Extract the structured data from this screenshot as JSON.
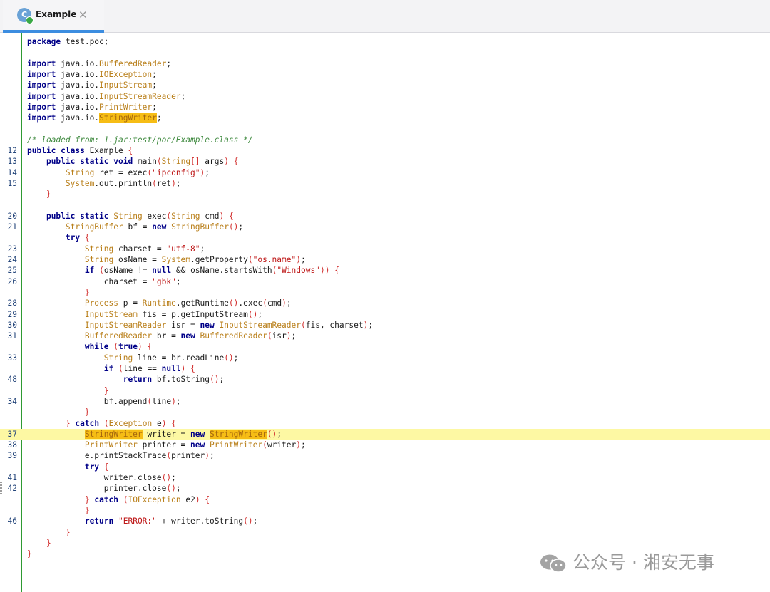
{
  "tab": {
    "title": "Example",
    "icon_letter": "C",
    "close_glyph": "✕"
  },
  "watermark": {
    "text": "公众号 · 湘安无事"
  },
  "colors": {
    "keyword": "#000088",
    "type": "#b97f1a",
    "string": "#bd1515",
    "comment": "#3f8a3f",
    "brace": "#d2302f",
    "highlight": "#f6bd15",
    "current_line": "#fdf8a3",
    "gutter_border": "#2e9a32"
  },
  "code_lines": [
    {
      "ln": "",
      "tokens": [
        [
          "kw",
          "package"
        ],
        [
          "pl",
          " test.poc;"
        ]
      ]
    },
    {
      "ln": "",
      "tokens": []
    },
    {
      "ln": "",
      "tokens": [
        [
          "kw",
          "import"
        ],
        [
          "pl",
          " java.io."
        ],
        [
          "ty",
          "BufferedReader"
        ],
        [
          "pl",
          ";"
        ]
      ]
    },
    {
      "ln": "",
      "tokens": [
        [
          "kw",
          "import"
        ],
        [
          "pl",
          " java.io."
        ],
        [
          "ty",
          "IOException"
        ],
        [
          "pl",
          ";"
        ]
      ]
    },
    {
      "ln": "",
      "tokens": [
        [
          "kw",
          "import"
        ],
        [
          "pl",
          " java.io."
        ],
        [
          "ty",
          "InputStream"
        ],
        [
          "pl",
          ";"
        ]
      ]
    },
    {
      "ln": "",
      "tokens": [
        [
          "kw",
          "import"
        ],
        [
          "pl",
          " java.io."
        ],
        [
          "ty",
          "InputStreamReader"
        ],
        [
          "pl",
          ";"
        ]
      ]
    },
    {
      "ln": "",
      "tokens": [
        [
          "kw",
          "import"
        ],
        [
          "pl",
          " java.io."
        ],
        [
          "ty",
          "PrintWriter"
        ],
        [
          "pl",
          ";"
        ]
      ]
    },
    {
      "ln": "",
      "tokens": [
        [
          "kw",
          "import"
        ],
        [
          "pl",
          " java.io."
        ],
        [
          "ty-hl",
          "StringWriter"
        ],
        [
          "pl",
          ";"
        ]
      ]
    },
    {
      "ln": "",
      "tokens": []
    },
    {
      "ln": "",
      "tokens": [
        [
          "cm",
          "/* loaded from: 1.jar:test/poc/Example.class */"
        ]
      ]
    },
    {
      "ln": "12",
      "tokens": [
        [
          "kw",
          "public class"
        ],
        [
          "pl",
          " Example "
        ],
        [
          "br",
          "{"
        ]
      ]
    },
    {
      "ln": "13",
      "tokens": [
        [
          "pl",
          "    "
        ],
        [
          "kw",
          "public static void"
        ],
        [
          "pl",
          " main"
        ],
        [
          "br",
          "("
        ],
        [
          "ty",
          "String"
        ],
        [
          "br",
          "[]"
        ],
        [
          "pl",
          " args"
        ],
        [
          "br",
          ")"
        ],
        [
          "pl",
          " "
        ],
        [
          "br",
          "{"
        ]
      ]
    },
    {
      "ln": "14",
      "tokens": [
        [
          "pl",
          "        "
        ],
        [
          "ty",
          "String"
        ],
        [
          "pl",
          " ret = exec"
        ],
        [
          "br",
          "("
        ],
        [
          "str",
          "\"ipconfig\""
        ],
        [
          "br",
          ")"
        ],
        [
          "pl",
          ";"
        ]
      ]
    },
    {
      "ln": "15",
      "tokens": [
        [
          "pl",
          "        "
        ],
        [
          "ty",
          "System"
        ],
        [
          "pl",
          ".out.println"
        ],
        [
          "br",
          "("
        ],
        [
          "pl",
          "ret"
        ],
        [
          "br",
          ")"
        ],
        [
          "pl",
          ";"
        ]
      ]
    },
    {
      "ln": "",
      "tokens": [
        [
          "pl",
          "    "
        ],
        [
          "br",
          "}"
        ]
      ]
    },
    {
      "ln": "",
      "tokens": []
    },
    {
      "ln": "20",
      "tokens": [
        [
          "pl",
          "    "
        ],
        [
          "kw",
          "public static"
        ],
        [
          "pl",
          " "
        ],
        [
          "ty",
          "String"
        ],
        [
          "pl",
          " exec"
        ],
        [
          "br",
          "("
        ],
        [
          "ty",
          "String"
        ],
        [
          "pl",
          " cmd"
        ],
        [
          "br",
          ")"
        ],
        [
          "pl",
          " "
        ],
        [
          "br",
          "{"
        ]
      ]
    },
    {
      "ln": "21",
      "tokens": [
        [
          "pl",
          "        "
        ],
        [
          "ty",
          "StringBuffer"
        ],
        [
          "pl",
          " bf = "
        ],
        [
          "kw",
          "new"
        ],
        [
          "pl",
          " "
        ],
        [
          "ty",
          "StringBuffer"
        ],
        [
          "br",
          "()"
        ],
        [
          "pl",
          ";"
        ]
      ]
    },
    {
      "ln": "",
      "tokens": [
        [
          "pl",
          "        "
        ],
        [
          "kw",
          "try"
        ],
        [
          "pl",
          " "
        ],
        [
          "br",
          "{"
        ]
      ]
    },
    {
      "ln": "23",
      "tokens": [
        [
          "pl",
          "            "
        ],
        [
          "ty",
          "String"
        ],
        [
          "pl",
          " charset = "
        ],
        [
          "str",
          "\"utf-8\""
        ],
        [
          "pl",
          ";"
        ]
      ]
    },
    {
      "ln": "24",
      "tokens": [
        [
          "pl",
          "            "
        ],
        [
          "ty",
          "String"
        ],
        [
          "pl",
          " osName = "
        ],
        [
          "ty",
          "System"
        ],
        [
          "pl",
          ".getProperty"
        ],
        [
          "br",
          "("
        ],
        [
          "str",
          "\"os.name\""
        ],
        [
          "br",
          ")"
        ],
        [
          "pl",
          ";"
        ]
      ]
    },
    {
      "ln": "25",
      "tokens": [
        [
          "pl",
          "            "
        ],
        [
          "kw",
          "if"
        ],
        [
          "pl",
          " "
        ],
        [
          "br",
          "("
        ],
        [
          "pl",
          "osName != "
        ],
        [
          "kw",
          "null"
        ],
        [
          "pl",
          " && osName.startsWith"
        ],
        [
          "br",
          "("
        ],
        [
          "str",
          "\"Windows\""
        ],
        [
          "br",
          "))"
        ],
        [
          "pl",
          " "
        ],
        [
          "br",
          "{"
        ]
      ]
    },
    {
      "ln": "26",
      "tokens": [
        [
          "pl",
          "                charset = "
        ],
        [
          "str",
          "\"gbk\""
        ],
        [
          "pl",
          ";"
        ]
      ]
    },
    {
      "ln": "",
      "tokens": [
        [
          "pl",
          "            "
        ],
        [
          "br",
          "}"
        ]
      ]
    },
    {
      "ln": "28",
      "tokens": [
        [
          "pl",
          "            "
        ],
        [
          "ty",
          "Process"
        ],
        [
          "pl",
          " p = "
        ],
        [
          "ty",
          "Runtime"
        ],
        [
          "pl",
          ".getRuntime"
        ],
        [
          "br",
          "()"
        ],
        [
          "pl",
          ".exec"
        ],
        [
          "br",
          "("
        ],
        [
          "pl",
          "cmd"
        ],
        [
          "br",
          ")"
        ],
        [
          "pl",
          ";"
        ]
      ]
    },
    {
      "ln": "29",
      "tokens": [
        [
          "pl",
          "            "
        ],
        [
          "ty",
          "InputStream"
        ],
        [
          "pl",
          " fis = p.getInputStream"
        ],
        [
          "br",
          "()"
        ],
        [
          "pl",
          ";"
        ]
      ]
    },
    {
      "ln": "30",
      "tokens": [
        [
          "pl",
          "            "
        ],
        [
          "ty",
          "InputStreamReader"
        ],
        [
          "pl",
          " isr = "
        ],
        [
          "kw",
          "new"
        ],
        [
          "pl",
          " "
        ],
        [
          "ty",
          "InputStreamReader"
        ],
        [
          "br",
          "("
        ],
        [
          "pl",
          "fis, charset"
        ],
        [
          "br",
          ")"
        ],
        [
          "pl",
          ";"
        ]
      ]
    },
    {
      "ln": "31",
      "tokens": [
        [
          "pl",
          "            "
        ],
        [
          "ty",
          "BufferedReader"
        ],
        [
          "pl",
          " br = "
        ],
        [
          "kw",
          "new"
        ],
        [
          "pl",
          " "
        ],
        [
          "ty",
          "BufferedReader"
        ],
        [
          "br",
          "("
        ],
        [
          "pl",
          "isr"
        ],
        [
          "br",
          ")"
        ],
        [
          "pl",
          ";"
        ]
      ]
    },
    {
      "ln": "",
      "tokens": [
        [
          "pl",
          "            "
        ],
        [
          "kw",
          "while"
        ],
        [
          "pl",
          " "
        ],
        [
          "br",
          "("
        ],
        [
          "kw",
          "true"
        ],
        [
          "br",
          ")"
        ],
        [
          "pl",
          " "
        ],
        [
          "br",
          "{"
        ]
      ]
    },
    {
      "ln": "33",
      "tokens": [
        [
          "pl",
          "                "
        ],
        [
          "ty",
          "String"
        ],
        [
          "pl",
          " line = br.readLine"
        ],
        [
          "br",
          "()"
        ],
        [
          "pl",
          ";"
        ]
      ]
    },
    {
      "ln": "",
      "tokens": [
        [
          "pl",
          "                "
        ],
        [
          "kw",
          "if"
        ],
        [
          "pl",
          " "
        ],
        [
          "br",
          "("
        ],
        [
          "pl",
          "line == "
        ],
        [
          "kw",
          "null"
        ],
        [
          "br",
          ")"
        ],
        [
          "pl",
          " "
        ],
        [
          "br",
          "{"
        ]
      ]
    },
    {
      "ln": "48",
      "tokens": [
        [
          "pl",
          "                    "
        ],
        [
          "kw",
          "return"
        ],
        [
          "pl",
          " bf.toString"
        ],
        [
          "br",
          "()"
        ],
        [
          "pl",
          ";"
        ]
      ]
    },
    {
      "ln": "",
      "tokens": [
        [
          "pl",
          "                "
        ],
        [
          "br",
          "}"
        ]
      ]
    },
    {
      "ln": "34",
      "tokens": [
        [
          "pl",
          "                bf.append"
        ],
        [
          "br",
          "("
        ],
        [
          "pl",
          "line"
        ],
        [
          "br",
          ")"
        ],
        [
          "pl",
          ";"
        ]
      ]
    },
    {
      "ln": "",
      "tokens": [
        [
          "pl",
          "            "
        ],
        [
          "br",
          "}"
        ]
      ]
    },
    {
      "ln": "",
      "tokens": [
        [
          "pl",
          "        "
        ],
        [
          "br",
          "}"
        ],
        [
          "pl",
          " "
        ],
        [
          "kw",
          "catch"
        ],
        [
          "pl",
          " "
        ],
        [
          "br",
          "("
        ],
        [
          "ty",
          "Exception"
        ],
        [
          "pl",
          " e"
        ],
        [
          "br",
          ")"
        ],
        [
          "pl",
          " "
        ],
        [
          "br",
          "{"
        ]
      ]
    },
    {
      "ln": "37",
      "current": true,
      "tokens": [
        [
          "pl",
          "            "
        ],
        [
          "ty-hl",
          "StringWriter"
        ],
        [
          "pl",
          " writer = "
        ],
        [
          "kw",
          "new"
        ],
        [
          "pl",
          " "
        ],
        [
          "ty-hl",
          "StringWriter"
        ],
        [
          "br",
          "()"
        ],
        [
          "pl",
          ";"
        ]
      ]
    },
    {
      "ln": "38",
      "tokens": [
        [
          "pl",
          "            "
        ],
        [
          "ty",
          "PrintWriter"
        ],
        [
          "pl",
          " printer = "
        ],
        [
          "kw",
          "new"
        ],
        [
          "pl",
          " "
        ],
        [
          "ty",
          "PrintWriter"
        ],
        [
          "br",
          "("
        ],
        [
          "pl",
          "writer"
        ],
        [
          "br",
          ")"
        ],
        [
          "pl",
          ";"
        ]
      ]
    },
    {
      "ln": "39",
      "tokens": [
        [
          "pl",
          "            e.printStackTrace"
        ],
        [
          "br",
          "("
        ],
        [
          "pl",
          "printer"
        ],
        [
          "br",
          ")"
        ],
        [
          "pl",
          ";"
        ]
      ]
    },
    {
      "ln": "",
      "tokens": [
        [
          "pl",
          "            "
        ],
        [
          "kw",
          "try"
        ],
        [
          "pl",
          " "
        ],
        [
          "br",
          "{"
        ]
      ]
    },
    {
      "ln": "41",
      "tokens": [
        [
          "pl",
          "                writer.close"
        ],
        [
          "br",
          "()"
        ],
        [
          "pl",
          ";"
        ]
      ]
    },
    {
      "ln": "42",
      "tokens": [
        [
          "pl",
          "                printer.close"
        ],
        [
          "br",
          "()"
        ],
        [
          "pl",
          ";"
        ]
      ]
    },
    {
      "ln": "",
      "tokens": [
        [
          "pl",
          "            "
        ],
        [
          "br",
          "}"
        ],
        [
          "pl",
          " "
        ],
        [
          "kw",
          "catch"
        ],
        [
          "pl",
          " "
        ],
        [
          "br",
          "("
        ],
        [
          "ty",
          "IOException"
        ],
        [
          "pl",
          " e2"
        ],
        [
          "br",
          ")"
        ],
        [
          "pl",
          " "
        ],
        [
          "br",
          "{"
        ]
      ]
    },
    {
      "ln": "",
      "tokens": [
        [
          "pl",
          "            "
        ],
        [
          "br",
          "}"
        ]
      ]
    },
    {
      "ln": "46",
      "tokens": [
        [
          "pl",
          "            "
        ],
        [
          "kw",
          "return"
        ],
        [
          "pl",
          " "
        ],
        [
          "str",
          "\"ERROR:\""
        ],
        [
          "pl",
          " + writer.toString"
        ],
        [
          "br",
          "()"
        ],
        [
          "pl",
          ";"
        ]
      ]
    },
    {
      "ln": "",
      "tokens": [
        [
          "pl",
          "        "
        ],
        [
          "br",
          "}"
        ]
      ]
    },
    {
      "ln": "",
      "tokens": [
        [
          "pl",
          "    "
        ],
        [
          "br",
          "}"
        ]
      ]
    },
    {
      "ln": "",
      "tokens": [
        [
          "br",
          "}"
        ]
      ]
    }
  ]
}
